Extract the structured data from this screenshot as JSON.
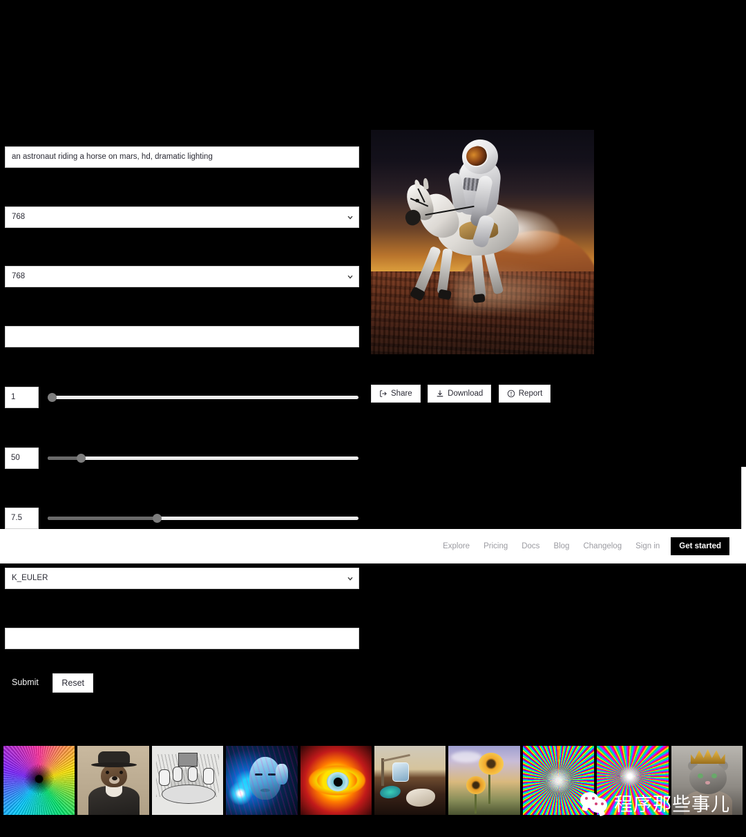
{
  "app": {
    "background_color": "#000000",
    "accent_color": "#ffffff"
  },
  "form": {
    "prompt": {
      "value": "an astronaut riding a horse on mars, hd, dramatic lighting",
      "placeholder": ""
    },
    "width_select": {
      "value": "768"
    },
    "height_select": {
      "value": "768"
    },
    "empty_field_1": {
      "value": "",
      "placeholder": ""
    },
    "sliders": [
      {
        "value": "1",
        "fill_percent": 0,
        "thumb_percent": 1
      },
      {
        "value": "50",
        "fill_percent": 10,
        "thumb_percent": 10
      },
      {
        "value": "7.5",
        "fill_percent": 35,
        "thumb_percent": 35
      }
    ],
    "scheduler_select": {
      "value": "K_EULER"
    },
    "empty_field_2": {
      "value": "",
      "placeholder": ""
    },
    "submit_label": "Submit",
    "reset_label": "Reset"
  },
  "result": {
    "image_alt": "an astronaut riding a horse on mars",
    "actions": [
      {
        "label": "Share",
        "icon": "share-icon"
      },
      {
        "label": "Download",
        "icon": "download-icon"
      },
      {
        "label": "Report",
        "icon": "report-icon"
      }
    ]
  },
  "nav": {
    "links": [
      "Explore",
      "Pricing",
      "Docs",
      "Blog",
      "Changelog",
      "Sign in"
    ],
    "cta_label": "Get started"
  },
  "gallery": {
    "thumbnails": [
      {
        "name": "rainbow-spiral-vortex"
      },
      {
        "name": "otter-in-bowler-hat-portrait"
      },
      {
        "name": "pencil-sketch-robots-at-table"
      },
      {
        "name": "cyan-cyborg-woman-headphones"
      },
      {
        "name": "yellow-red-abstract-eye"
      },
      {
        "name": "surreal-melting-watch-landscape"
      },
      {
        "name": "sunflowers-in-field"
      },
      {
        "name": "rainbow-radial-burst"
      },
      {
        "name": "prismatic-starburst-streaks"
      },
      {
        "name": "cat-wearing-golden-crown"
      }
    ]
  },
  "watermark": {
    "text": "程序那些事儿",
    "icon": "wechat-icon"
  }
}
